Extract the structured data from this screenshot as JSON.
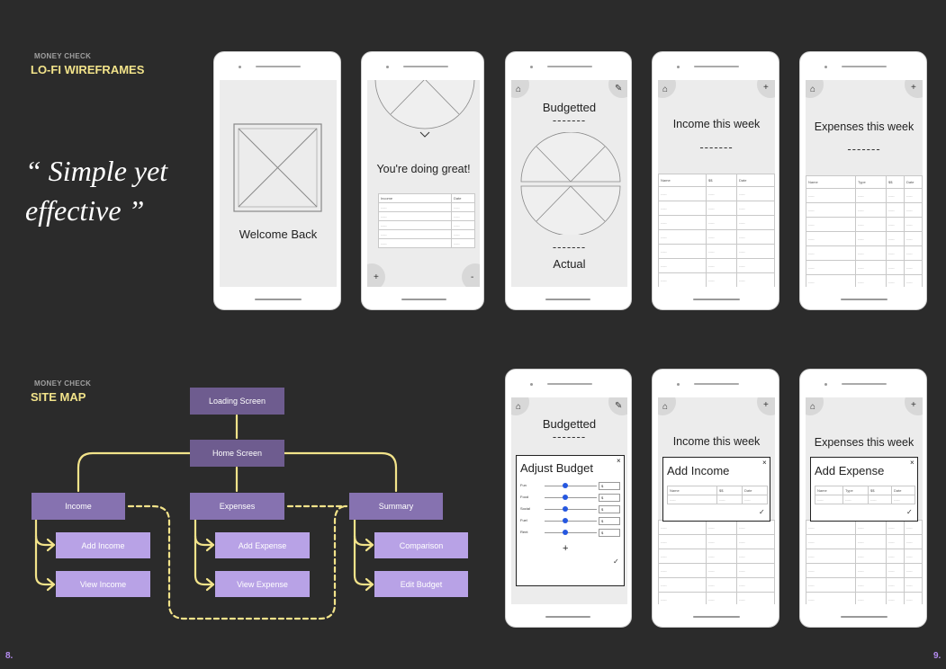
{
  "wireframes": {
    "eyebrow": "MONEY CHECK",
    "heading": "LO-FI WIREFRAMES",
    "quote_line1": "“ Simple yet",
    "quote_line2": "effective ”"
  },
  "sitemap": {
    "eyebrow": "MONEY CHECK",
    "heading": "SITE MAP",
    "nodes": {
      "loading": "Loading Screen",
      "home": "Home Screen",
      "income": "Income",
      "expenses": "Expenses",
      "summary": "Summary",
      "add_income": "Add Income",
      "view_income": "View Income",
      "add_expense": "Add Expense",
      "view_expense": "View Expense",
      "comparison": "Comparison",
      "edit_budget": "Edit Budget"
    }
  },
  "screens": {
    "welcome": {
      "text": "Welcome Back"
    },
    "great": {
      "text": "You're doing great!",
      "col1": "Income",
      "col2": "Date",
      "cell": "-----",
      "plus": "+",
      "minus": "-"
    },
    "budget": {
      "title": "Budgetted",
      "dashes": "-------",
      "actual": "Actual"
    },
    "income_week": {
      "title": "Income this week",
      "dashes": "-------",
      "cols": [
        "Name",
        "$$",
        "Date"
      ],
      "cell": "-----",
      "plus": "+"
    },
    "expenses_week": {
      "title": "Expenses this week",
      "dashes": "-------",
      "cols": [
        "Name",
        "Type",
        "$$",
        "Date"
      ],
      "cell": "-----",
      "plus": "+"
    },
    "adjust_budget": {
      "title": "Adjust Budget",
      "rows": [
        {
          "label": "Fun",
          "value": "$"
        },
        {
          "label": "Food",
          "value": "$"
        },
        {
          "label": "Social",
          "value": "$"
        },
        {
          "label": "Fuel",
          "value": "$"
        },
        {
          "label": "Rent",
          "value": "$"
        }
      ],
      "plus": "+",
      "check": "✓",
      "close": "×"
    },
    "add_income": {
      "title": "Add Income",
      "cols": [
        "Name",
        "$$",
        "Date"
      ],
      "cell": "-----",
      "check": "✓",
      "close": "×"
    },
    "add_expense": {
      "title": "Add Expense",
      "cols": [
        "Name",
        "Type",
        "$$",
        "Date"
      ],
      "cell": "-----",
      "check": "✓",
      "close": "×"
    }
  },
  "page_numbers": {
    "left": "8.",
    "right": "9."
  },
  "colors": {
    "background": "#2b2b2b",
    "accent_yellow": "#f2e38a",
    "node_dark": "#6e5c8f",
    "node_mid": "#8672b0",
    "node_light": "#b8a2e6",
    "slider": "#2557e0"
  }
}
